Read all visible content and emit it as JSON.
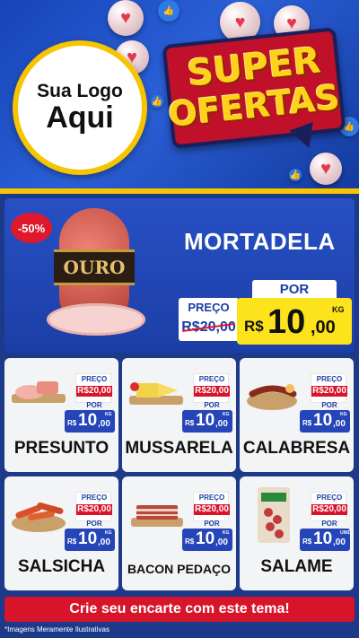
{
  "header": {
    "logo_line1": "Sua Logo",
    "logo_line2": "Aqui",
    "badge_line1": "SUPER",
    "badge_line2": "OFERTAS"
  },
  "featured": {
    "discount": "-50%",
    "product_label": "OURO",
    "name": "MORTADELA",
    "por_label": "POR",
    "preco_label": "PREÇO",
    "old_price": "R$20,00",
    "currency": "R$",
    "price_int": "10",
    "price_dec": ",00",
    "unit": "KG"
  },
  "products": [
    {
      "name": "PRESUNTO",
      "preco_label": "PREÇO",
      "old_price": "R$20,00",
      "por_label": "POR",
      "currency": "R$",
      "price_int": "10",
      "price_dec": ",00",
      "unit": "KG"
    },
    {
      "name": "MUSSARELA",
      "preco_label": "PREÇO",
      "old_price": "R$20,00",
      "por_label": "POR",
      "currency": "R$",
      "price_int": "10",
      "price_dec": ",00",
      "unit": "KG"
    },
    {
      "name": "CALABRESA",
      "preco_label": "PREÇO",
      "old_price": "R$20,00",
      "por_label": "POR",
      "currency": "R$",
      "price_int": "10",
      "price_dec": ",00",
      "unit": "KG"
    },
    {
      "name": "SALSICHA",
      "preco_label": "PREÇO",
      "old_price": "R$20,00",
      "por_label": "POR",
      "currency": "R$",
      "price_int": "10",
      "price_dec": ",00",
      "unit": "KG"
    },
    {
      "name": "BACON PEDAÇO",
      "preco_label": "PREÇO",
      "old_price": "R$20,00",
      "por_label": "POR",
      "currency": "R$",
      "price_int": "10",
      "price_dec": ",00",
      "unit": "KG"
    },
    {
      "name": "SALAME",
      "preco_label": "PREÇO",
      "old_price": "R$20,00",
      "por_label": "POR",
      "currency": "R$",
      "price_int": "10",
      "price_dec": ",00",
      "unit": "UNID"
    }
  ],
  "cta": "Crie seu encarte com este tema!",
  "footnote": "*Imagens Meramente Ilustrativas",
  "colors": {
    "brand_blue": "#1c3ea6",
    "accent_red": "#d8142a",
    "accent_yellow": "#fce31c"
  }
}
